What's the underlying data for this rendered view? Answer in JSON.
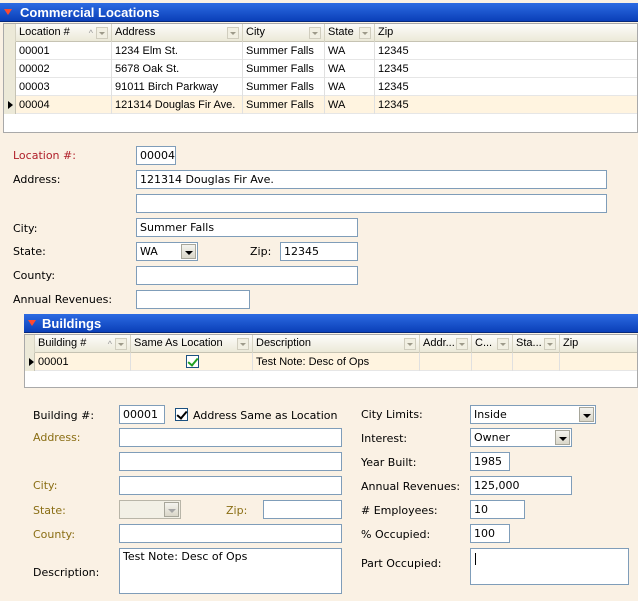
{
  "locations": {
    "section_title": "Commercial Locations",
    "columns": [
      {
        "label": "Location #",
        "sort": "^"
      },
      {
        "label": "Address"
      },
      {
        "label": "City"
      },
      {
        "label": "State"
      },
      {
        "label": "Zip"
      }
    ],
    "rows": [
      {
        "location": "00001",
        "address": "1234 Elm St.",
        "city": "Summer Falls",
        "state": "WA",
        "zip": "12345"
      },
      {
        "location": "00002",
        "address": "5678 Oak St.",
        "city": "Summer Falls",
        "state": "WA",
        "zip": "12345"
      },
      {
        "location": "00003",
        "address": "91011 Birch Parkway",
        "city": "Summer Falls",
        "state": "WA",
        "zip": "12345"
      },
      {
        "location": "00004",
        "address": "121314 Douglas Fir Ave.",
        "city": "Summer Falls",
        "state": "WA",
        "zip": "12345"
      }
    ]
  },
  "location_form": {
    "location_label": "Location #:",
    "location_value": "00004",
    "address_label": "Address:",
    "address1_value": "121314 Douglas Fir Ave.",
    "address2_value": "",
    "city_label": "City:",
    "city_value": "Summer Falls",
    "state_label": "State:",
    "state_value": "WA",
    "zip_label": "Zip:",
    "zip_value": "12345",
    "county_label": "County:",
    "county_value": "",
    "revenues_label": "Annual Revenues:",
    "revenues_value": ""
  },
  "buildings": {
    "section_title": "Buildings",
    "columns": [
      {
        "label": "Building #",
        "sort": "^"
      },
      {
        "label": "Same As Location"
      },
      {
        "label": "Description"
      },
      {
        "label": "Addr..."
      },
      {
        "label": "C..."
      },
      {
        "label": "Sta..."
      },
      {
        "label": "Zip"
      }
    ],
    "rows": [
      {
        "building": "00001",
        "same_as_location": true,
        "description": "Test Note: Desc of Ops",
        "addr": "",
        "city": "",
        "state": "",
        "zip": ""
      }
    ]
  },
  "building_form": {
    "building_label": "Building #:",
    "building_value": "00001",
    "same_as_location_label": "Address Same as Location",
    "address_label": "Address:",
    "address1_value": "",
    "address2_value": "",
    "city_label": "City:",
    "city_value": "",
    "state_label": "State:",
    "state_value": "",
    "zip_label": "Zip:",
    "zip_value": "",
    "county_label": "County:",
    "county_value": "",
    "description_label": "Description:",
    "description_value": "Test Note: Desc of Ops",
    "city_limits_label": "City Limits:",
    "city_limits_value": "Inside",
    "interest_label": "Interest:",
    "interest_value": "Owner",
    "year_built_label": "Year Built:",
    "year_built_value": "1985",
    "annual_revenues_label": "Annual Revenues:",
    "annual_revenues_value": "125,000",
    "employees_label": "# Employees:",
    "employees_value": "10",
    "occupied_label": "% Occupied:",
    "occupied_value": "100",
    "part_occupied_label": "Part Occupied:",
    "part_occupied_value": ""
  },
  "colors": {
    "header_bar": "#0A3FB8",
    "background": "#FAF1E4",
    "required_label": "#B0202A",
    "disabled_label": "#8A6E14"
  }
}
